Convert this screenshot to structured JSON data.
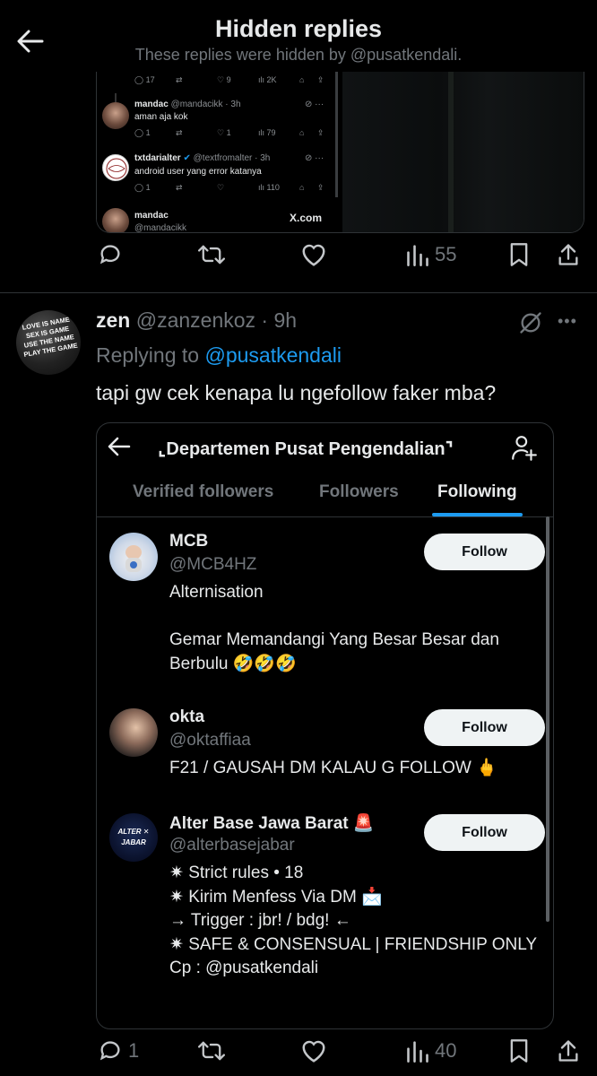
{
  "header": {
    "title": "Hidden replies",
    "subtitle": "These replies were hidden by @pusatkendali."
  },
  "embed": {
    "top_row": {
      "replies": "17",
      "likes": "9",
      "views": "2K"
    },
    "items": [
      {
        "name": "mandac",
        "handle": "@mandacikk · 3h",
        "text": "aman aja kok",
        "replies": "1",
        "likes": "1",
        "views": "79"
      },
      {
        "name": "txtdarialter",
        "handle": "@textfromalter · 3h",
        "text": "android user yang error katanya",
        "replies": "1",
        "likes": "",
        "views": "110"
      },
      {
        "name": "mandac",
        "handle": "@mandacikk",
        "text": ""
      }
    ],
    "watermark": "X.com"
  },
  "top_actions": {
    "views": "55"
  },
  "reply": {
    "name": "zen",
    "meta": "@zanzenkoz · 9h",
    "replying_prefix": "Replying to ",
    "replying_mention": "@pusatkendali",
    "text": "tapi gw cek kenapa lu ngefollow faker mba?",
    "avatar_text": "LOVE IS NAME SEX IS GAME USE THE NAME PLAY THE GAME"
  },
  "inner": {
    "title": "⌞Departemen Pusat Pengendalian⌝",
    "tabs": [
      "Verified followers",
      "Followers",
      "Following"
    ],
    "active_tab": "Following",
    "users": [
      {
        "name": "MCB",
        "handle": "@MCB4HZ",
        "bio": "Alternisation\n\nGemar Memandangi Yang Besar Besar dan Berbulu 🤣🤣🤣",
        "button": "Follow"
      },
      {
        "name": "okta",
        "handle": "@oktaffiaa",
        "bio": "F21 / GAUSAH DM KALAU G FOLLOW 🖕",
        "button": "Follow"
      },
      {
        "name": "Alter Base Jawa Barat 🚨",
        "handle": "@alterbasejabar",
        "bio": "✷ Strict rules • 18\n✷ Kirim Menfess Via DM 📩\n→ Trigger : jbr! / bdg! ←\n✷ SAFE & CONSENSUAL | FRIENDSHIP ONLY\nCp : @pusatkendali",
        "button": "Follow",
        "avatar_text": "ALTER ✕ JABAR"
      }
    ]
  },
  "bottom_actions": {
    "replies": "1",
    "views": "40"
  },
  "colors": {
    "accent": "#1d9bf0",
    "text": "#e7e9ea",
    "muted": "#71767b",
    "border": "#2f3336"
  }
}
